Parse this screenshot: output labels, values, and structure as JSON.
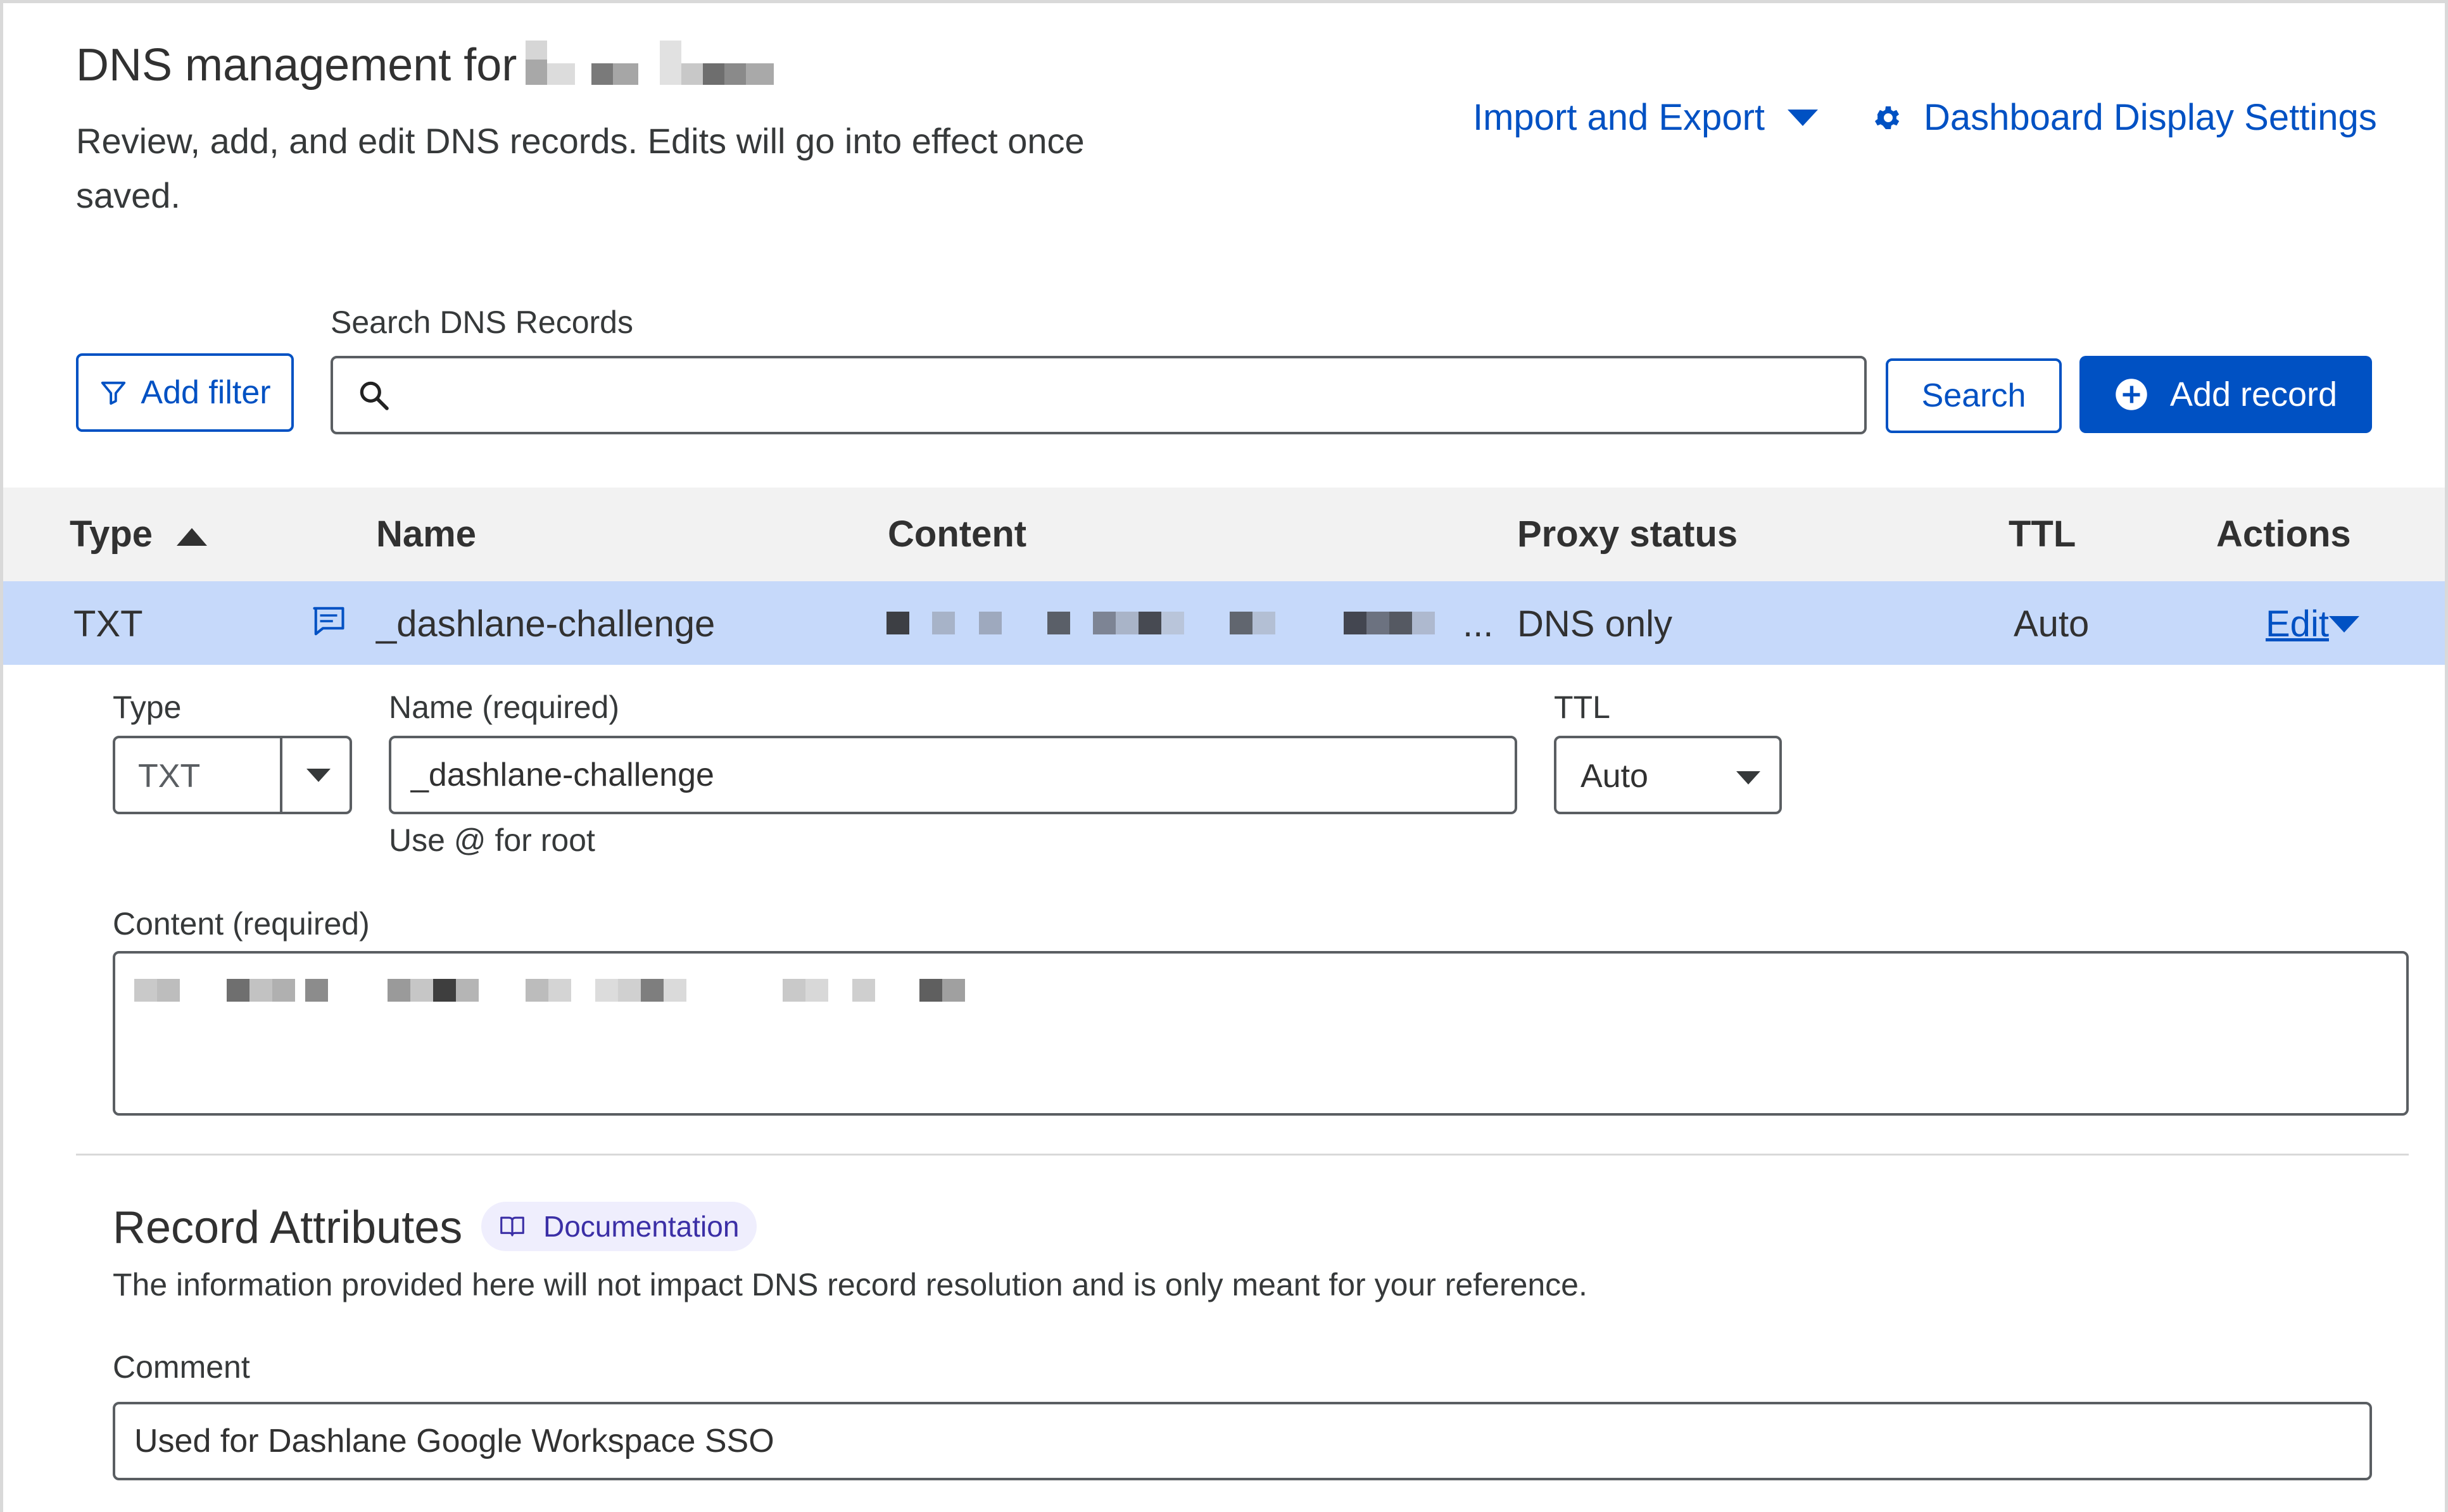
{
  "header": {
    "title": "DNS management for",
    "description": "Review, add, and edit DNS records. Edits will go into effect once saved.",
    "import_export_label": "Import and Export",
    "dashboard_settings_label": "Dashboard Display Settings"
  },
  "toolbar": {
    "add_filter_label": "Add filter",
    "search_label": "Search DNS Records",
    "search_placeholder": "",
    "search_value": "",
    "search_button_label": "Search",
    "add_record_label": "Add record"
  },
  "table": {
    "columns": [
      "Type",
      "Name",
      "Content",
      "Proxy status",
      "TTL",
      "Actions"
    ],
    "sort_column": "Type",
    "rows": [
      {
        "type": "TXT",
        "name": "_dashlane-challenge",
        "content_suffix": "...",
        "proxy_status": "DNS only",
        "ttl": "Auto",
        "action": "Edit"
      }
    ]
  },
  "edit_form": {
    "type_label": "Type",
    "type_value": "TXT",
    "name_label": "Name (required)",
    "name_value": "_dashlane-challenge",
    "name_hint": "Use @ for root",
    "ttl_label": "TTL",
    "ttl_value": "Auto",
    "content_label": "Content (required)"
  },
  "record_attributes": {
    "title": "Record Attributes",
    "documentation_label": "Documentation",
    "description": "The information provided here will not impact DNS record resolution and is only meant for your reference.",
    "comment_label": "Comment",
    "comment_value": "Used for Dashlane Google Workspace SSO"
  },
  "colors": {
    "accent": "#0051c3",
    "selected_row": "#c6d9fa",
    "header_row": "#f2f2f2",
    "badge_bg": "#efeefd",
    "badge_text": "#3b2fa6"
  },
  "icons": {
    "filter": "filter-icon",
    "search": "search-icon",
    "add": "plus-circle-icon",
    "settings": "gear-icon",
    "comment": "comment-icon",
    "book": "book-icon",
    "sort": "sort-ascending-icon",
    "dropdown": "caret-down-icon"
  }
}
